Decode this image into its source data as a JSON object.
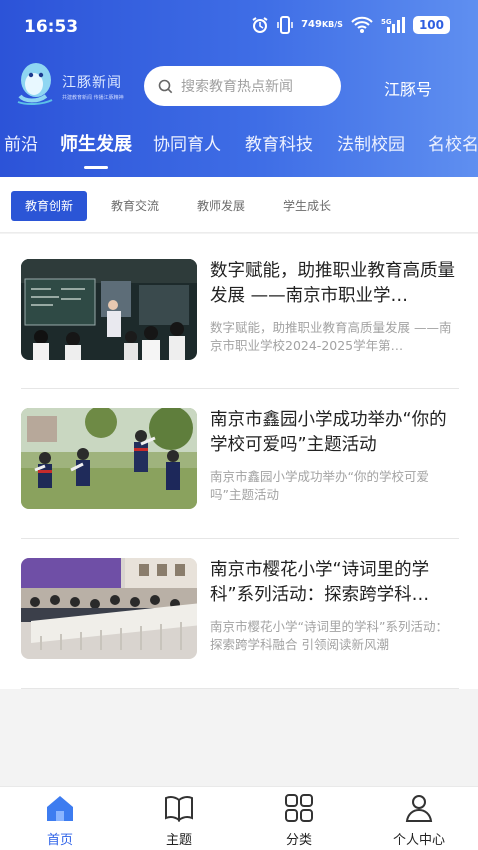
{
  "status_bar": {
    "time": "16:53",
    "net_speed_value": "749",
    "net_speed_unit": "KB/S",
    "signal_label": "5G",
    "battery": "100"
  },
  "header": {
    "logo_text": "江豚新闻",
    "logo_tagline": "共建教育新闻 传播江豚精神",
    "search_placeholder": "搜索教育热点新闻",
    "channel_button": "江豚号"
  },
  "tabs": [
    {
      "label": "前沿",
      "active": false
    },
    {
      "label": "师生发展",
      "active": true
    },
    {
      "label": "协同育人",
      "active": false
    },
    {
      "label": "教育科技",
      "active": false
    },
    {
      "label": "法制校园",
      "active": false
    },
    {
      "label": "名校名",
      "active": false
    }
  ],
  "subtabs": [
    {
      "label": "教育创新",
      "active": true
    },
    {
      "label": "教育交流",
      "active": false
    },
    {
      "label": "教师发展",
      "active": false
    },
    {
      "label": "学生成长",
      "active": false
    }
  ],
  "articles": [
    {
      "title": "数字赋能，助推职业教育高质量发展 ——南京市职业学…",
      "summary": "数字赋能，助推职业教育高质量发展 ——南京市职业学校2024-2025学年第…"
    },
    {
      "title": "南京市鑫园小学成功举办“你的学校可爱吗”主题活动",
      "summary": "南京市鑫园小学成功举办“你的学校可爱吗”主题活动"
    },
    {
      "title": "南京市樱花小学“诗词里的学科”系列活动：探索跨学科…",
      "summary": "南京市樱花小学“诗词里的学科”系列活动：探索跨学科融合 引领阅读新风潮"
    }
  ],
  "bottom_nav": [
    {
      "label": "首页",
      "icon": "home-icon",
      "active": true
    },
    {
      "label": "主题",
      "icon": "book-icon",
      "active": false
    },
    {
      "label": "分类",
      "icon": "grid-icon",
      "active": false
    },
    {
      "label": "个人中心",
      "icon": "user-icon",
      "active": false
    }
  ],
  "colors": {
    "accent": "#2b55d6",
    "header_gradient_start": "#2c53d8",
    "header_gradient_end": "#5f8ff0",
    "active_nav": "#2f63e8"
  }
}
